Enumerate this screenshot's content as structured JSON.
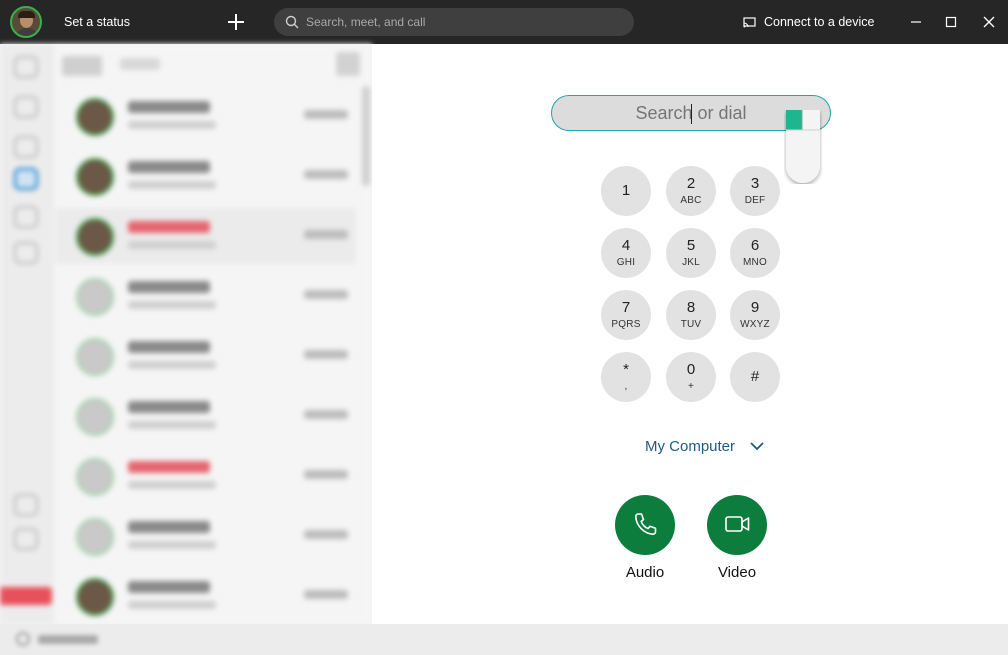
{
  "titlebar": {
    "status_label": "Set a status",
    "search_placeholder": "Search, meet, and call",
    "connect_label": "Connect to a device"
  },
  "dialpad": {
    "input_placeholder": "Search or dial",
    "keys": [
      {
        "digit": "1",
        "letters": ""
      },
      {
        "digit": "2",
        "letters": "ABC"
      },
      {
        "digit": "3",
        "letters": "DEF"
      },
      {
        "digit": "4",
        "letters": "GHI"
      },
      {
        "digit": "5",
        "letters": "JKL"
      },
      {
        "digit": "6",
        "letters": "MNO"
      },
      {
        "digit": "7",
        "letters": "PQRS"
      },
      {
        "digit": "8",
        "letters": "TUV"
      },
      {
        "digit": "9",
        "letters": "WXYZ"
      },
      {
        "digit": "*",
        "letters": ","
      },
      {
        "digit": "0",
        "letters": "+"
      },
      {
        "digit": "#",
        "letters": ""
      }
    ],
    "device_label": "My Computer",
    "audio_label": "Audio",
    "video_label": "Video"
  },
  "colors": {
    "titlebar_bg": "#262626",
    "call_green": "#0c7d3c",
    "device_text": "#1d5b83",
    "key_bg": "#e2e2e2",
    "input_border": "#1aa7a7"
  },
  "icons": {
    "avatar": "user-avatar",
    "new": "plus-icon",
    "search": "search-icon",
    "cast": "cast-icon",
    "device_dropdown": "chevron-down-icon",
    "audio": "phone-icon",
    "video": "video-camera-icon",
    "cursor_hint": "mouse-icon"
  }
}
